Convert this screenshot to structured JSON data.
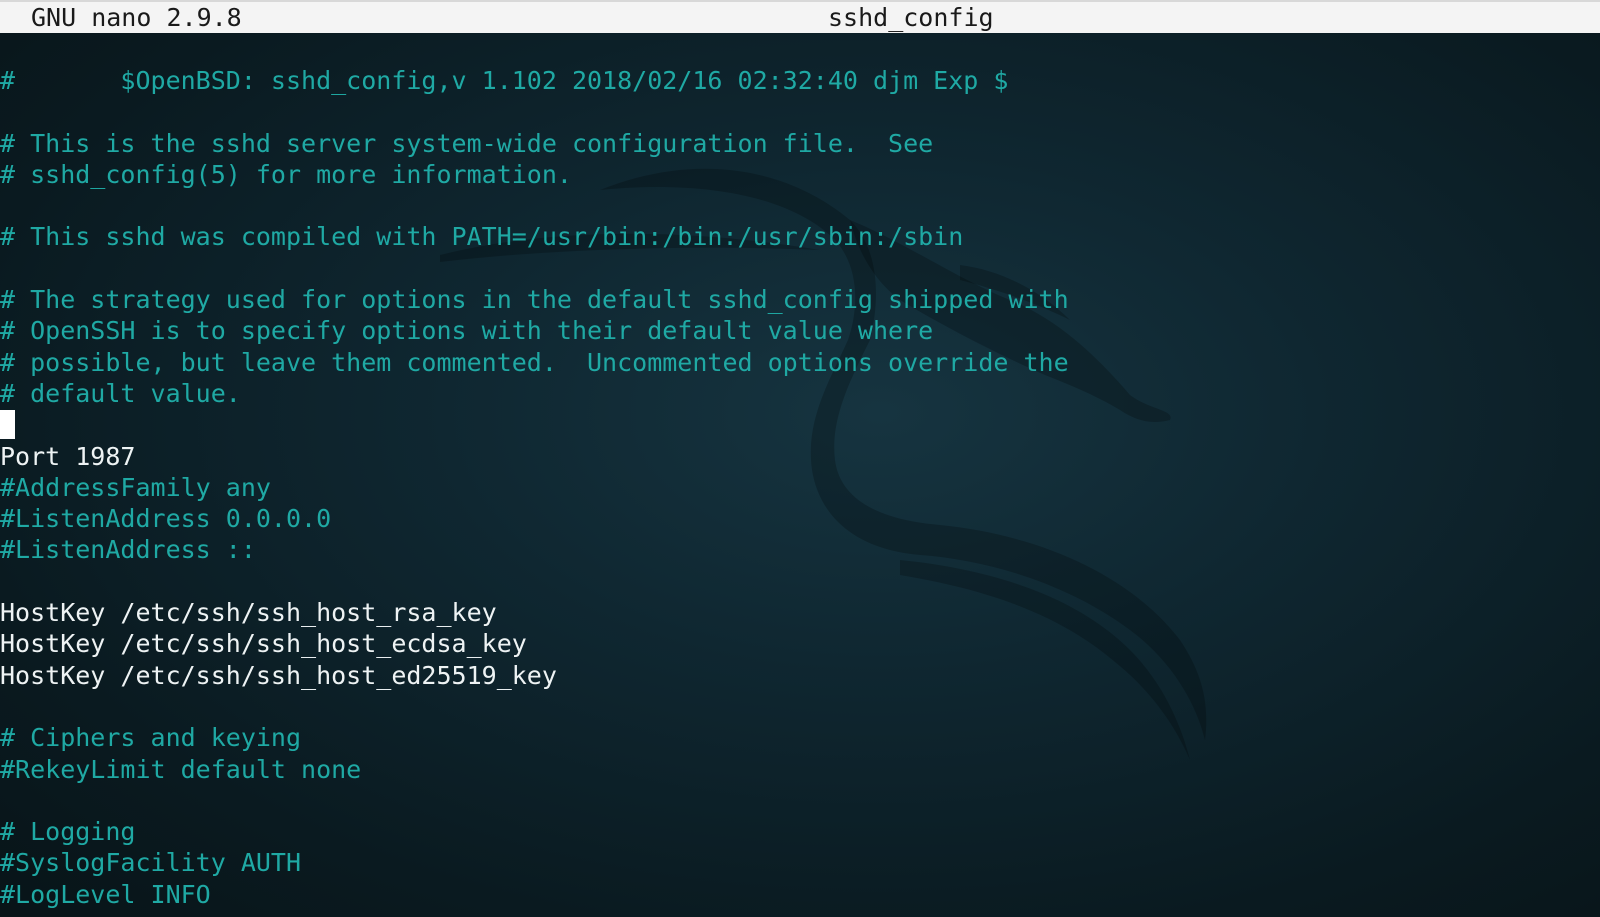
{
  "titlebar": {
    "app_name": "GNU nano 2.9.8",
    "file_name": "sshd_config"
  },
  "colors": {
    "comment": "#1fa9a4",
    "directive": "#eef3f4",
    "background": "#0f2731",
    "titlebar_bg": "#f4f4f4"
  },
  "background_icon": "kali-dragon-icon",
  "editor": {
    "lines": [
      "#       $OpenBSD: sshd_config,v 1.102 2018/02/16 02:32:40 djm Exp $",
      "",
      "# This is the sshd server system-wide configuration file.  See",
      "# sshd_config(5) for more information.",
      "",
      "# This sshd was compiled with PATH=/usr/bin:/bin:/usr/sbin:/sbin",
      "",
      "# The strategy used for options in the default sshd_config shipped with",
      "# OpenSSH is to specify options with their default value where",
      "# possible, but leave them commented.  Uncommented options override the",
      "# default value.",
      "",
      "Port 1987",
      "#AddressFamily any",
      "#ListenAddress 0.0.0.0",
      "#ListenAddress ::",
      "",
      "HostKey /etc/ssh/ssh_host_rsa_key",
      "HostKey /etc/ssh/ssh_host_ecdsa_key",
      "HostKey /etc/ssh/ssh_host_ed25519_key",
      "",
      "# Ciphers and keying",
      "#RekeyLimit default none",
      "",
      "# Logging",
      "#SyslogFacility AUTH",
      "#LogLevel INFO"
    ]
  }
}
